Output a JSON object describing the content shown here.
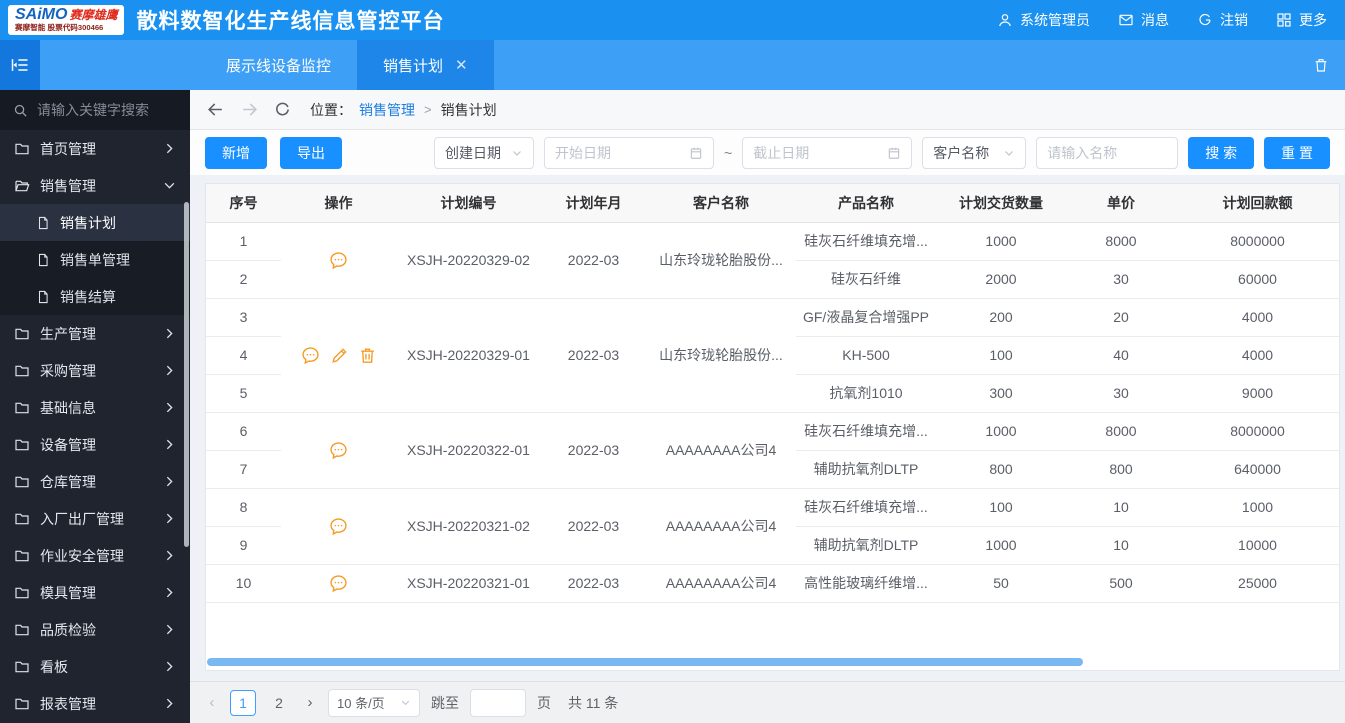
{
  "colors": {
    "primary": "#1890ff",
    "header_bg": "#1a91f0",
    "tabbar_bg": "#3d9ff5",
    "tab_active_bg": "#1e86e8",
    "sidebar_bg": "#20242f",
    "op_icon": "#f59b22",
    "scrollbar_thumb": "#79b8f1"
  },
  "header": {
    "logo": {
      "brand": "SAiMO",
      "brand_suffix": "赛摩雄鹰",
      "subtitle": "赛摩智能 股票代码300466"
    },
    "title": "散料数智化生产线信息管控平台",
    "actions": [
      {
        "icon": "user-icon",
        "label": "系统管理员"
      },
      {
        "icon": "message-icon",
        "label": "消息"
      },
      {
        "icon": "logout-icon",
        "label": "注销"
      },
      {
        "icon": "more-icon",
        "label": "更多"
      }
    ]
  },
  "tabbar": {
    "tabs": [
      {
        "label": "展示线设备监控",
        "active": false,
        "closable": false
      },
      {
        "label": "销售计划",
        "active": true,
        "closable": true
      }
    ],
    "close_glyph": "✕"
  },
  "sidebar": {
    "search_placeholder": "请输入关键字搜索",
    "items": [
      {
        "label": "首页管理",
        "icon": "folder",
        "chevron": "right"
      },
      {
        "label": "销售管理",
        "icon": "folder-open",
        "chevron": "down",
        "expanded": true,
        "children": [
          {
            "label": "销售计划",
            "icon": "file",
            "active": true
          },
          {
            "label": "销售单管理",
            "icon": "file",
            "active": false
          },
          {
            "label": "销售结算",
            "icon": "file",
            "active": false
          }
        ]
      },
      {
        "label": "生产管理",
        "icon": "folder",
        "chevron": "right"
      },
      {
        "label": "采购管理",
        "icon": "folder",
        "chevron": "right"
      },
      {
        "label": "基础信息",
        "icon": "folder",
        "chevron": "right"
      },
      {
        "label": "设备管理",
        "icon": "folder",
        "chevron": "right"
      },
      {
        "label": "仓库管理",
        "icon": "folder",
        "chevron": "right"
      },
      {
        "label": "入厂出厂管理",
        "icon": "folder",
        "chevron": "right"
      },
      {
        "label": "作业安全管理",
        "icon": "folder",
        "chevron": "right"
      },
      {
        "label": "模具管理",
        "icon": "folder",
        "chevron": "right"
      },
      {
        "label": "品质检验",
        "icon": "folder",
        "chevron": "right"
      },
      {
        "label": "看板",
        "icon": "folder",
        "chevron": "right"
      },
      {
        "label": "报表管理",
        "icon": "folder",
        "chevron": "right"
      }
    ]
  },
  "breadcrumb": {
    "label": "位置：",
    "parent": "销售管理",
    "separator": ">",
    "current": "销售计划"
  },
  "toolbar": {
    "add_label": "新增",
    "export_label": "导出",
    "date_type_value": "创建日期",
    "start_placeholder": "开始日期",
    "range_separator": "~",
    "end_placeholder": "截止日期",
    "filter_field_value": "客户名称",
    "name_placeholder": "请输入名称",
    "search_label": "搜 索",
    "reset_label": "重 置"
  },
  "table": {
    "columns": [
      "序号",
      "操作",
      "计划编号",
      "计划年月",
      "客户名称",
      "产品名称",
      "计划交货数量",
      "单价",
      "计划回款额"
    ],
    "groups": [
      {
        "plan_no": "XSJH-20220329-02",
        "plan_month": "2022-03",
        "customer": "山东玲珑轮胎股份...",
        "ops": [
          "comment"
        ],
        "rows": [
          {
            "no": "1",
            "product": "硅灰石纤维填充增...",
            "qty": "1000",
            "price": "8000",
            "amount": "8000000"
          },
          {
            "no": "2",
            "product": "硅灰石纤维",
            "qty": "2000",
            "price": "30",
            "amount": "60000"
          }
        ]
      },
      {
        "plan_no": "XSJH-20220329-01",
        "plan_month": "2022-03",
        "customer": "山东玲珑轮胎股份...",
        "ops": [
          "comment",
          "edit",
          "delete"
        ],
        "rows": [
          {
            "no": "3",
            "product": "GF/液晶复合增强PP",
            "qty": "200",
            "price": "20",
            "amount": "4000"
          },
          {
            "no": "4",
            "product": "KH-500",
            "qty": "100",
            "price": "40",
            "amount": "4000"
          },
          {
            "no": "5",
            "product": "抗氧剂1010",
            "qty": "300",
            "price": "30",
            "amount": "9000"
          }
        ]
      },
      {
        "plan_no": "XSJH-20220322-01",
        "plan_month": "2022-03",
        "customer": "AAAAAAAA公司4",
        "ops": [
          "comment"
        ],
        "rows": [
          {
            "no": "6",
            "product": "硅灰石纤维填充增...",
            "qty": "1000",
            "price": "8000",
            "amount": "8000000"
          },
          {
            "no": "7",
            "product": "辅助抗氧剂DLTP",
            "qty": "800",
            "price": "800",
            "amount": "640000"
          }
        ]
      },
      {
        "plan_no": "XSJH-20220321-02",
        "plan_month": "2022-03",
        "customer": "AAAAAAAA公司4",
        "ops": [
          "comment"
        ],
        "rows": [
          {
            "no": "8",
            "product": "硅灰石纤维填充增...",
            "qty": "100",
            "price": "10",
            "amount": "1000"
          },
          {
            "no": "9",
            "product": "辅助抗氧剂DLTP",
            "qty": "1000",
            "price": "10",
            "amount": "10000"
          }
        ]
      },
      {
        "plan_no": "XSJH-20220321-01",
        "plan_month": "2022-03",
        "customer": "AAAAAAAA公司4",
        "ops": [
          "comment"
        ],
        "rows": [
          {
            "no": "10",
            "product": "高性能玻璃纤维增...",
            "qty": "50",
            "price": "500",
            "amount": "25000"
          }
        ]
      }
    ]
  },
  "pagination": {
    "prev": "‹",
    "next": "›",
    "pages": [
      "1",
      "2"
    ],
    "active_page": "1",
    "page_size_value": "10 条/页",
    "jump_label": "跳至",
    "jump_unit": "页",
    "total_text": "共 11 条"
  }
}
